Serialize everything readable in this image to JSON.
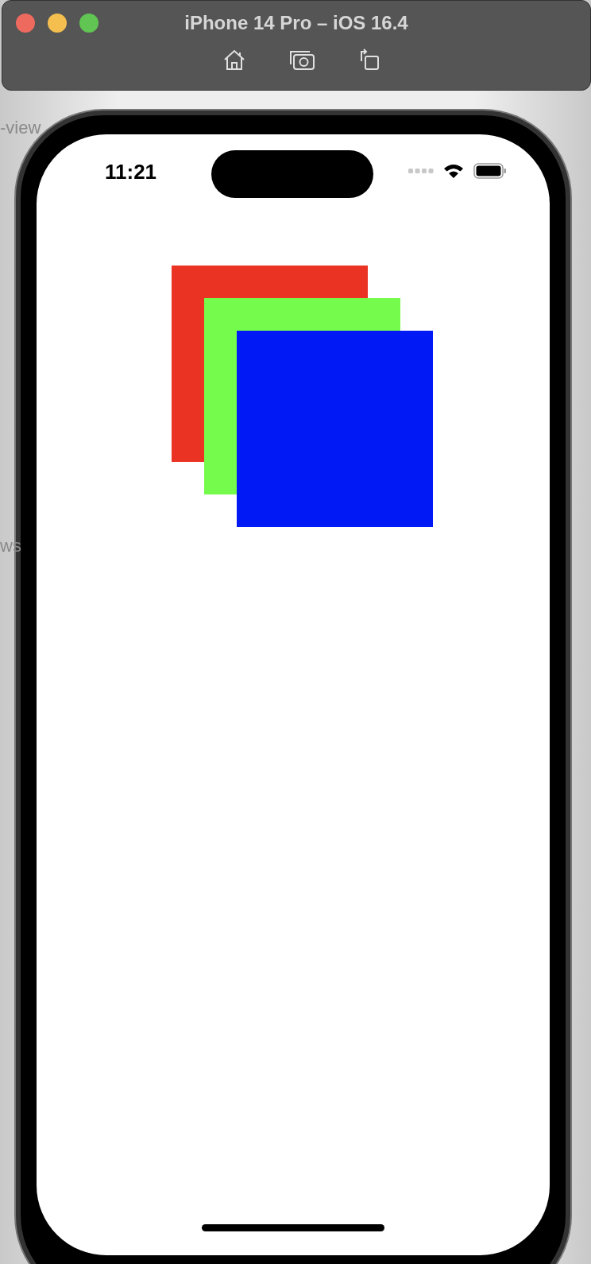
{
  "window": {
    "title": "iPhone 14 Pro – iOS 16.4"
  },
  "background_text": [
    "-view",
    "ws"
  ],
  "status_bar": {
    "time": "11:21"
  },
  "views": [
    {
      "color": "#eb3324"
    },
    {
      "color": "#75fb4c"
    },
    {
      "color": "#0019f5"
    }
  ]
}
